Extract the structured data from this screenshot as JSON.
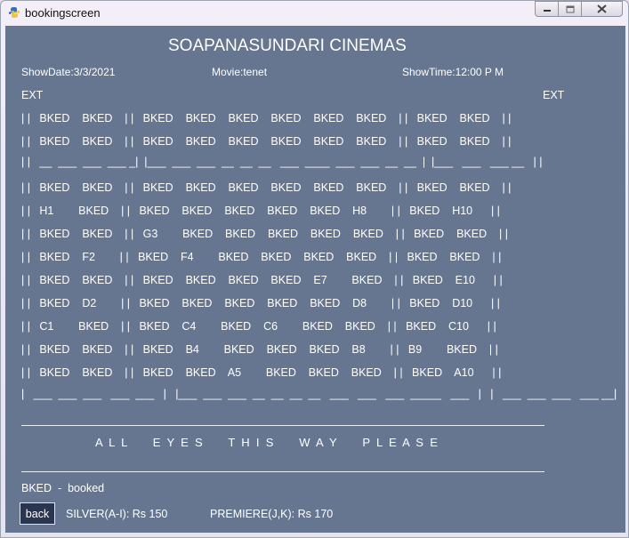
{
  "window": {
    "title": "bookingscreen"
  },
  "header": {
    "cinema_name": "SOAPANASUNDARI CINEMAS",
    "show_date": "ShowDate:3/3/2021",
    "movie": "Movie:tenet",
    "show_time": "ShowTime:12:00 P M"
  },
  "exits": {
    "left": "EXT",
    "right": "EXT"
  },
  "seat_rows": [
    "| |   BKED    BKED    | |   BKED    BKED    BKED    BKED    BKED    BKED    | |   BKED    BKED    | |",
    "| |   BKED    BKED    | |   BKED    BKED    BKED    BKED    BKED    BKED    | |   BKED    BKED    | |",
    "| |   __  ___  ___  ___ _|  |___  ___  ___  __  __  __   ___  ____  ___  ___  __  __  |  |___   ___   ___ __   | |",
    "| |   BKED    BKED    | |   BKED    BKED    BKED    BKED    BKED    BKED    | |   BKED    BKED    | |",
    "| |   H1        BKED    | |   BKED    BKED    BKED    BKED    BKED    H8        | |   BKED    H10      | |",
    "| |   BKED    BKED    | |   G3        BKED    BKED    BKED    BKED    BKED    | |   BKED    BKED    | |",
    "| |   BKED    F2        | |   BKED    F4        BKED    BKED    BKED    BKED    | |   BKED    BKED    | |",
    "| |   BKED    BKED    | |   BKED    BKED    BKED    BKED    E7        BKED    | |   BKED    E10      | |",
    "| |   BKED    D2        | |   BKED    BKED    BKED    BKED    BKED    D8        | |   BKED    D10      | |",
    "| |   C1        BKED    | |   BKED    C4        BKED    C6        BKED    BKED    | |   BKED    C10      | |",
    "| |   BKED    BKED    | |   BKED    B4        BKED    BKED    BKED    B8        | |   B9        BKED    | |",
    "| |   BKED    BKED    | |   BKED    BKED    A5        BKED    BKED    BKED    | |   BKED    A10      | |",
    "|   ___  ___  ___   ___  ___   |   |___  ___  ___  __  __  __  __   ___   ___   ___  _____   ___   |   |   ___  ___  ___   ___ __|"
  ],
  "screen_text": "A  L  L        E  Y  E  S        T  H  I  S        W  A  Y        P  L  E  A  S  E",
  "legend": "BKED  -  booked",
  "back_label": "back",
  "prices": {
    "silver": "SILVER(A-I): Rs 150",
    "premiere": "PREMIERE(J,K): Rs 170"
  }
}
